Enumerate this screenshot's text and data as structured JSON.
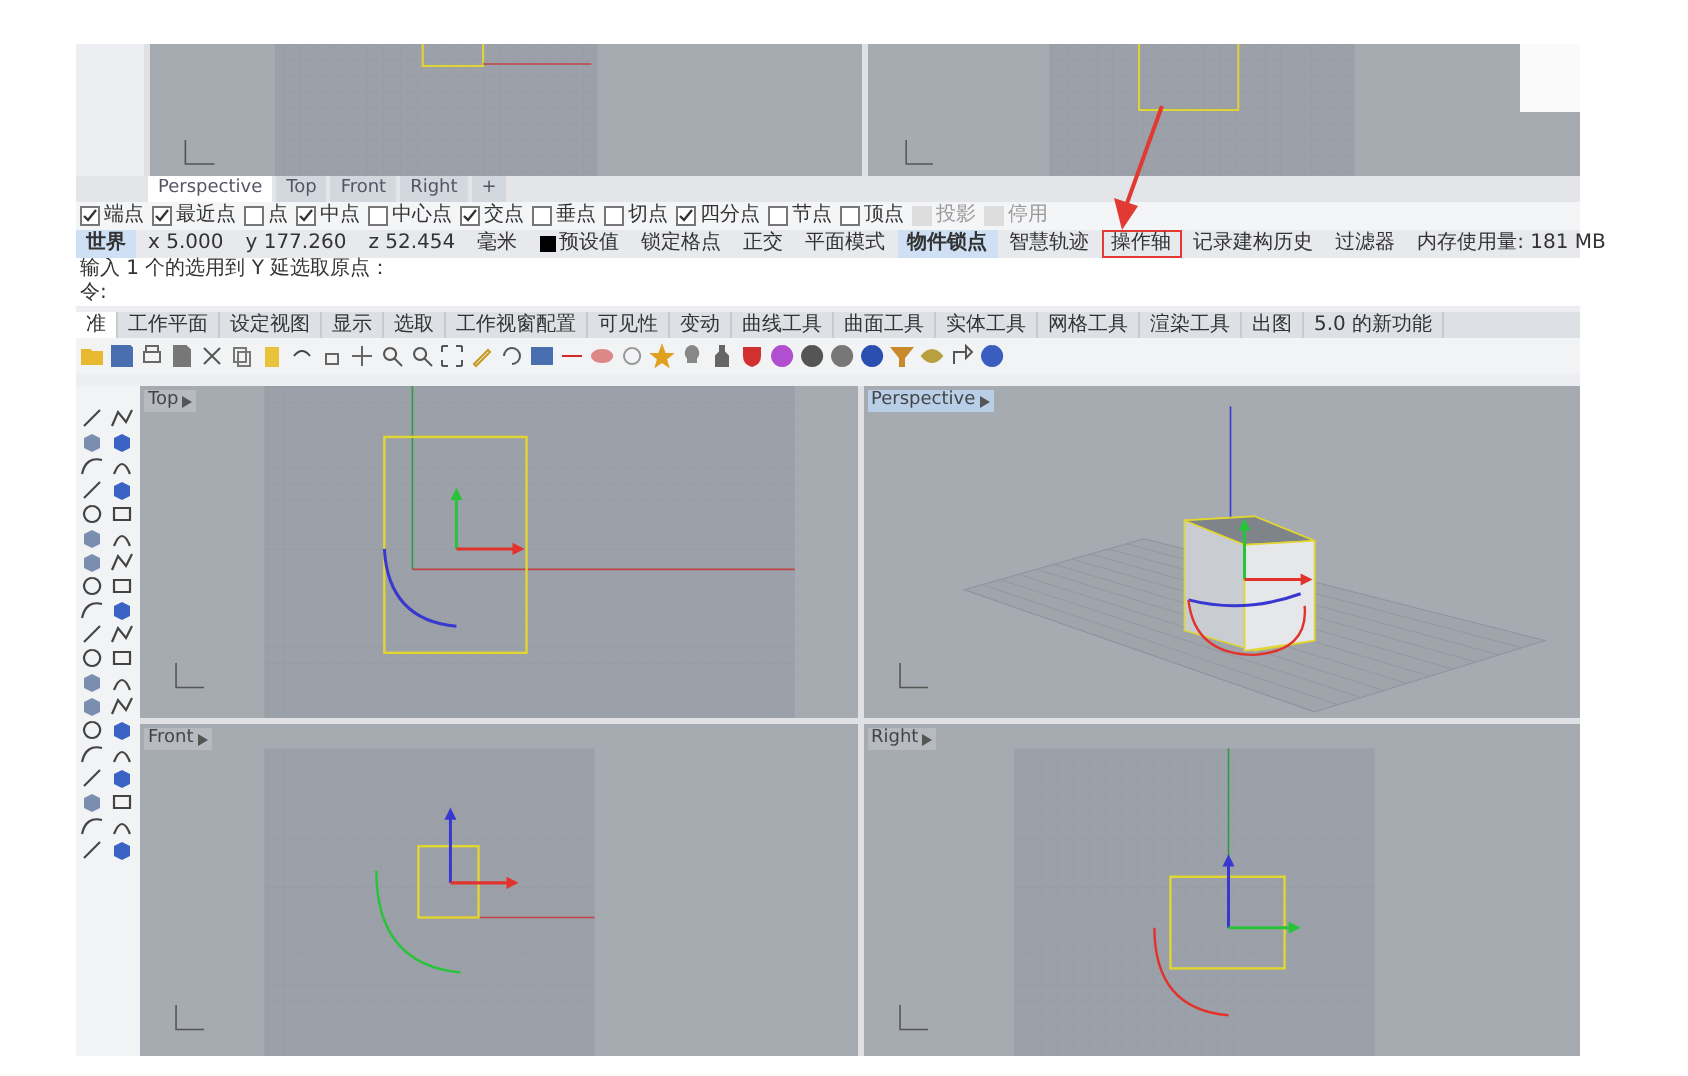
{
  "upper_viewports": [
    {
      "kind": "top_fragment"
    },
    {
      "kind": "right_fragment"
    }
  ],
  "viewport_tabs": [
    {
      "label": "Perspective",
      "selected": true
    },
    {
      "label": "Top",
      "selected": false
    },
    {
      "label": "Front",
      "selected": false
    },
    {
      "label": "Right",
      "selected": false
    },
    {
      "label": "+",
      "selected": false
    }
  ],
  "osnaps": [
    {
      "label": "端点",
      "checked": true,
      "disabled": false
    },
    {
      "label": "最近点",
      "checked": true,
      "disabled": false
    },
    {
      "label": "点",
      "checked": false,
      "disabled": false
    },
    {
      "label": "中点",
      "checked": true,
      "disabled": false
    },
    {
      "label": "中心点",
      "checked": false,
      "disabled": false
    },
    {
      "label": "交点",
      "checked": true,
      "disabled": false
    },
    {
      "label": "垂点",
      "checked": false,
      "disabled": false
    },
    {
      "label": "切点",
      "checked": false,
      "disabled": false
    },
    {
      "label": "四分点",
      "checked": true,
      "disabled": false
    },
    {
      "label": "节点",
      "checked": false,
      "disabled": false
    },
    {
      "label": "顶点",
      "checked": false,
      "disabled": false
    },
    {
      "label": "投影",
      "checked": false,
      "disabled": true
    },
    {
      "label": "停用",
      "checked": false,
      "disabled": true
    }
  ],
  "status_bar": [
    {
      "text": "世界",
      "kind": "pane",
      "active": true,
      "highlighted": false
    },
    {
      "text": "x 5.000",
      "kind": "pane",
      "active": false,
      "highlighted": false
    },
    {
      "text": "y 177.260",
      "kind": "pane",
      "active": false,
      "highlighted": false
    },
    {
      "text": "z 52.454",
      "kind": "pane",
      "active": false,
      "highlighted": false
    },
    {
      "text": "毫米",
      "kind": "pane",
      "active": false,
      "highlighted": false
    },
    {
      "text": "预设值",
      "kind": "layer",
      "active": false,
      "highlighted": false
    },
    {
      "text": "锁定格点",
      "kind": "pane",
      "active": false,
      "highlighted": false
    },
    {
      "text": "正交",
      "kind": "pane",
      "active": false,
      "highlighted": false
    },
    {
      "text": "平面模式",
      "kind": "pane",
      "active": false,
      "highlighted": false
    },
    {
      "text": "物件锁点",
      "kind": "pane",
      "active": true,
      "highlighted": false
    },
    {
      "text": "智慧轨迹",
      "kind": "pane",
      "active": false,
      "highlighted": false
    },
    {
      "text": "操作轴",
      "kind": "pane",
      "active": false,
      "highlighted": true
    },
    {
      "text": "记录建构历史",
      "kind": "pane",
      "active": false,
      "highlighted": false
    },
    {
      "text": "过滤器",
      "kind": "pane",
      "active": false,
      "highlighted": false
    },
    {
      "text": "内存使用量: 181 MB",
      "kind": "pane",
      "active": false,
      "highlighted": false
    }
  ],
  "command_history": "输入 1 个的选用到 Y 延选取原点：",
  "command_prompt": "令:",
  "menu_tabs": [
    {
      "label": "准",
      "selected": true
    },
    {
      "label": "工作平面",
      "selected": false
    },
    {
      "label": "设定视图",
      "selected": false
    },
    {
      "label": "显示",
      "selected": false
    },
    {
      "label": "选取",
      "selected": false
    },
    {
      "label": "工作视窗配置",
      "selected": false
    },
    {
      "label": "可见性",
      "selected": false
    },
    {
      "label": "变动",
      "selected": false
    },
    {
      "label": "曲线工具",
      "selected": false
    },
    {
      "label": "曲面工具",
      "selected": false
    },
    {
      "label": "实体工具",
      "selected": false
    },
    {
      "label": "网格工具",
      "selected": false
    },
    {
      "label": "渲染工具",
      "selected": false
    },
    {
      "label": "出图",
      "selected": false
    },
    {
      "label": "5.0 的新功能",
      "selected": false
    }
  ],
  "viewports": [
    {
      "label": "Top",
      "kind": "top",
      "active": false
    },
    {
      "label": "Perspective",
      "kind": "perspective",
      "active": true
    },
    {
      "label": "Front",
      "kind": "front",
      "active": false
    },
    {
      "label": "Right",
      "kind": "right",
      "active": false
    }
  ]
}
